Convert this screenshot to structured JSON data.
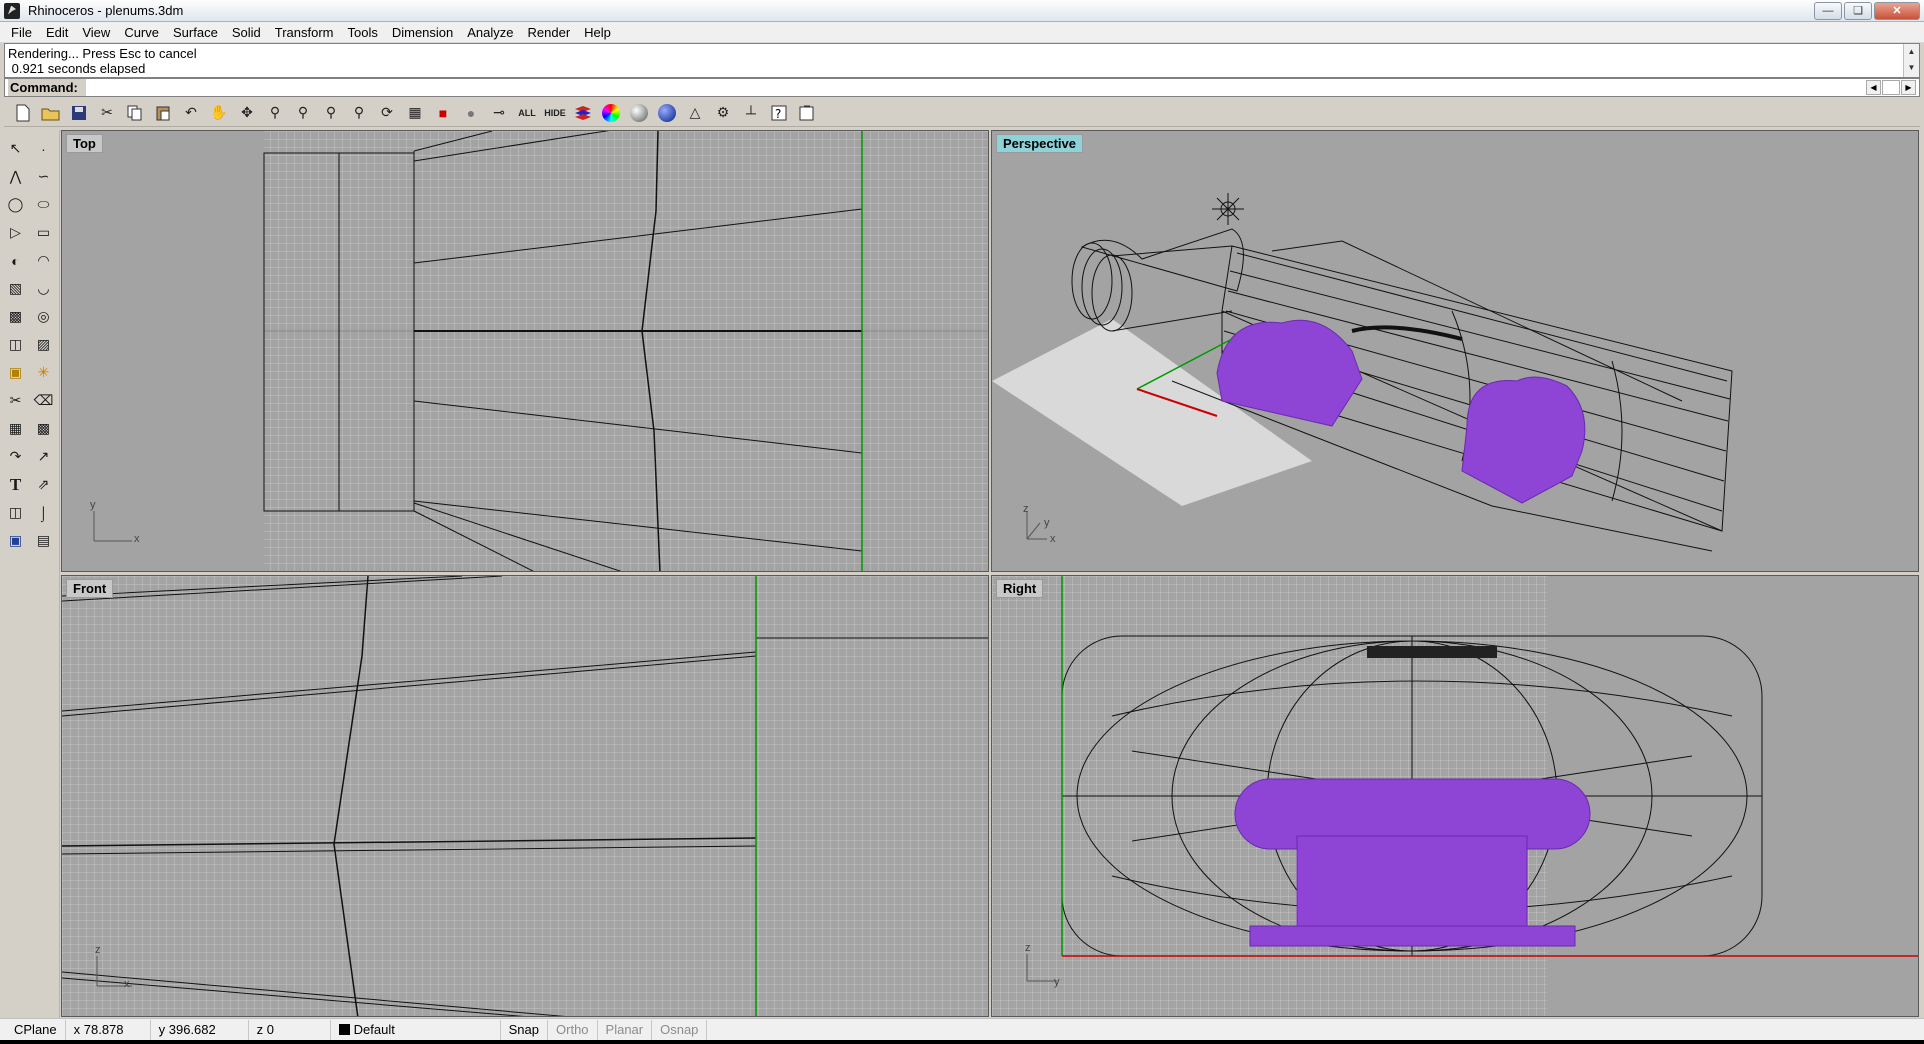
{
  "window": {
    "title": "Rhinoceros - plenums.3dm",
    "minimize_icon": "minimize-icon",
    "restore_icon": "restore-icon",
    "close_icon": "close-icon"
  },
  "menu": [
    "File",
    "Edit",
    "View",
    "Curve",
    "Surface",
    "Solid",
    "Transform",
    "Tools",
    "Dimension",
    "Analyze",
    "Render",
    "Help"
  ],
  "messages": {
    "line1": "Rendering... Press Esc to cancel",
    "line2": " 0.921 seconds elapsed"
  },
  "command": {
    "label": "Command:",
    "value": ""
  },
  "toolbar_icons": [
    "new-file-icon",
    "open-file-icon",
    "save-icon",
    "cut-icon",
    "copy-icon",
    "paste-icon",
    "undo-icon",
    "pan-hand-icon",
    "rotate-view-icon",
    "zoom-dynamic-icon",
    "zoom-window-icon",
    "zoom-extents-icon",
    "zoom-selected-icon",
    "undo-view-icon",
    "four-viewports-icon",
    "car-icon",
    "hide-icon",
    "show-icon",
    "text-ALL",
    "text-HIDE",
    "layers-icon",
    "color-wheel-icon",
    "shaded-sphere-icon",
    "render-sphere-icon",
    "light-icon",
    "gear-options-icon",
    "dimension-icon",
    "help-icon",
    "properties-icon"
  ],
  "toolbar_text": {
    "all": "ALL",
    "hide": "HIDE"
  },
  "sidebar_icons": [
    "select-arrow-icon",
    "point-icon",
    "polyline-icon",
    "curve-icon",
    "circle-icon",
    "ellipse-icon",
    "arc-icon",
    "rectangle-icon",
    "polygon-icon",
    "fillet-icon",
    "surface-icon",
    "sweep-icon",
    "box-solid-icon",
    "boolean-icon",
    "cylinder-icon",
    "extrude-icon",
    "edit-point-icon",
    "explode-icon",
    "trim-icon",
    "split-icon",
    "group-icon",
    "ungroup-icon",
    "transform-icon",
    "scale-icon",
    "text-icon",
    "dimension-icon",
    "array-icon",
    "analyze-icon",
    "render-window-icon",
    "grid-icon"
  ],
  "viewports": {
    "top": {
      "label": "Top",
      "axis_x": "x",
      "axis_y": "y"
    },
    "perspective": {
      "label": "Perspective",
      "axis_x": "x",
      "axis_y": "y",
      "axis_z": "z"
    },
    "front": {
      "label": "Front",
      "axis_x": "x",
      "axis_z": "z"
    },
    "right": {
      "label": "Right",
      "axis_y": "y",
      "axis_z": "z"
    }
  },
  "status": {
    "cplane": "CPlane",
    "x": "x 78.878",
    "y": "y 396.682",
    "z": "z 0",
    "layer": "Default",
    "snap": "Snap",
    "ortho": "Ortho",
    "planar": "Planar",
    "osnap": "Osnap"
  },
  "colors": {
    "active_viewport_label": "#8fd3da",
    "plenum_fill": "#8e44d4",
    "x_axis": "#cc0000",
    "y_axis": "#00a000"
  }
}
